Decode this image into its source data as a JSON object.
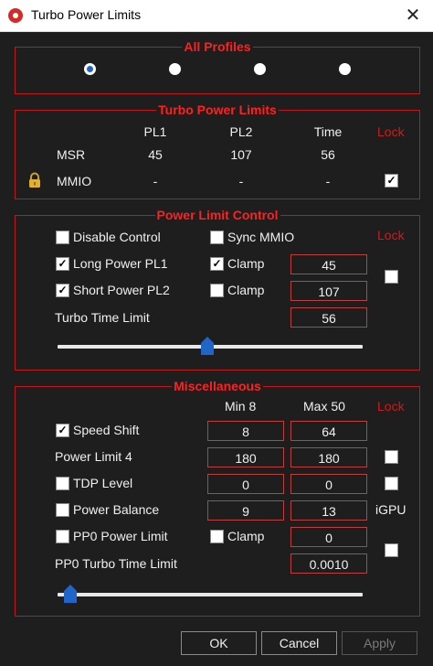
{
  "window": {
    "title": "Turbo Power Limits",
    "close_glyph": "✕",
    "icon": "app-icon"
  },
  "all_profiles": {
    "title": "All Profiles",
    "selected_index": 0,
    "count": 4
  },
  "turbo_power_limits": {
    "title": "Turbo Power Limits",
    "headers": {
      "pl1": "PL1",
      "pl2": "PL2",
      "time": "Time",
      "lock": "Lock"
    },
    "rows": [
      {
        "name": "MSR",
        "pl1": "45",
        "pl2": "107",
        "time": "56"
      },
      {
        "name": "MMIO",
        "pl1": "-",
        "pl2": "-",
        "time": "-",
        "icon": "lock-icon"
      }
    ],
    "lock_checked": true
  },
  "power_limit_control": {
    "title": "Power Limit Control",
    "lock_label": "Lock",
    "disable_control": {
      "label": "Disable Control",
      "checked": false
    },
    "sync_mmio": {
      "label": "Sync MMIO",
      "checked": false
    },
    "long_power": {
      "label": "Long Power PL1",
      "checked": true,
      "clamp_label": "Clamp",
      "clamp_checked": true,
      "value": "45"
    },
    "short_power": {
      "label": "Short Power PL2",
      "checked": true,
      "clamp_label": "Clamp",
      "clamp_checked": false,
      "value": "107"
    },
    "turbo_time": {
      "label": "Turbo Time Limit",
      "value": "56"
    },
    "lock_checked": false,
    "slider_fraction": 0.49
  },
  "miscellaneous": {
    "title": "Miscellaneous",
    "min_label": "Min  8",
    "max_label": "Max  50",
    "lock_label": "Lock",
    "igpu_label": "iGPU",
    "speed_shift": {
      "label": "Speed Shift",
      "checked": true,
      "min": "8",
      "max": "64"
    },
    "power_limit_4": {
      "label": "Power Limit 4",
      "min": "180",
      "max": "180",
      "lock_checked": false
    },
    "tdp_level": {
      "label": "TDP Level",
      "checked": false,
      "min": "0",
      "max": "0",
      "lock_checked": false
    },
    "power_balance": {
      "label": "Power Balance",
      "checked": false,
      "min": "9",
      "max": "13"
    },
    "pp0_power_limit": {
      "label": "PP0 Power Limit",
      "checked": false,
      "clamp_label": "Clamp",
      "clamp_checked": false,
      "value": "0",
      "lock_checked": false
    },
    "pp0_turbo_time": {
      "label": "PP0 Turbo Time Limit",
      "value": "0.0010"
    },
    "slider_fraction": 0.02
  },
  "buttons": {
    "ok": "OK",
    "cancel": "Cancel",
    "apply": "Apply"
  },
  "colors": {
    "accent_red": "#ff2020",
    "selected_radio": "#1f66c8",
    "background": "#1e1e1e"
  }
}
